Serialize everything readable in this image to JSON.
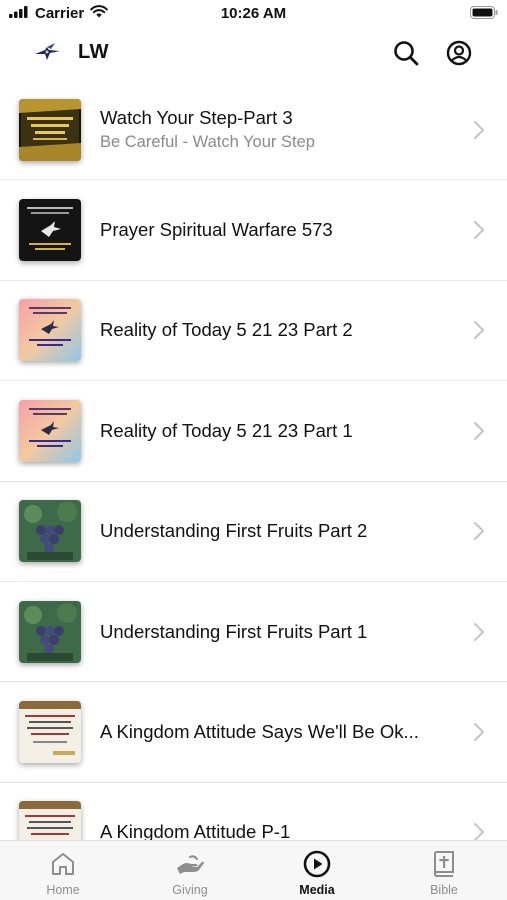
{
  "status_bar": {
    "carrier": "Carrier",
    "time": "10:26 AM"
  },
  "header": {
    "title": "LW",
    "search_icon": "search-icon",
    "account_icon": "account-icon"
  },
  "media_items": [
    {
      "title": "Watch Your Step-Part 3",
      "subtitle": "Be Careful - Watch Your Step",
      "thumb_style": "gold"
    },
    {
      "title": "Prayer Spiritual Warfare 573",
      "subtitle": "",
      "thumb_style": "dark"
    },
    {
      "title": "Reality of Today 5 21 23 Part 2",
      "subtitle": "",
      "thumb_style": "pastel"
    },
    {
      "title": "Reality of Today 5 21 23 Part 1",
      "subtitle": "",
      "thumb_style": "pastel"
    },
    {
      "title": "Understanding First Fruits Part 2",
      "subtitle": "",
      "thumb_style": "grapes"
    },
    {
      "title": "Understanding First Fruits Part 1",
      "subtitle": "",
      "thumb_style": "grapes"
    },
    {
      "title": "A Kingdom Attitude Says We'll Be Ok...",
      "subtitle": "",
      "thumb_style": "paper"
    },
    {
      "title": "A Kingdom Attitude P-1",
      "subtitle": "",
      "thumb_style": "paper"
    }
  ],
  "tabs": [
    {
      "label": "Home",
      "icon": "home-icon",
      "active": false
    },
    {
      "label": "Giving",
      "icon": "giving-hand-icon",
      "active": false
    },
    {
      "label": "Media",
      "icon": "play-circle-icon",
      "active": true
    },
    {
      "label": "Bible",
      "icon": "bible-icon",
      "active": false
    }
  ],
  "colors": {
    "active": "#111111",
    "inactive": "#8e8e8e",
    "chevron": "#c4c4c4",
    "divider": "#e8e8e8"
  }
}
